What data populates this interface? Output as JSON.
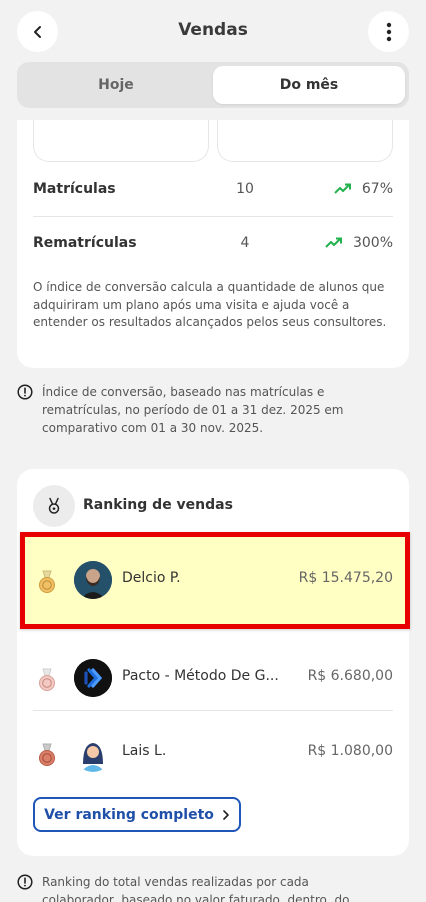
{
  "header": {
    "title": "Vendas",
    "back_icon": "chevron-left-icon",
    "more_icon": "more-vertical-icon"
  },
  "tabs": [
    {
      "label": "Hoje",
      "selected": false
    },
    {
      "label": "Do mês",
      "selected": true
    }
  ],
  "conversion": {
    "rows": [
      {
        "label": "Matrículas",
        "value": "10",
        "trend": "67%",
        "trend_icon": "trend-up-icon",
        "trend_color": "#22b14c"
      },
      {
        "label": "Rematrículas",
        "value": "4",
        "trend": "300%",
        "trend_icon": "trend-up-icon",
        "trend_color": "#22b14c"
      }
    ],
    "explanation": "O índice de conversão calcula a quantidade de alunos que adquiriram um plano após uma visita e ajuda você a entender os resultados alcançados pelos seus consultores."
  },
  "conversion_note": "Índice de conversão, baseado nas matrículas e rematrículas, no período de 01 a 31 dez. 2025 em comparativo com 01 a 30 nov. 2025.",
  "ranking": {
    "title": "Ranking de vendas",
    "icon": "medal-icon",
    "items": [
      {
        "medal": "gold",
        "name": "Delcio P.",
        "value": "R$ 15.475,20"
      },
      {
        "medal": "silver",
        "name": "Pacto - Método De G...",
        "value": "R$ 6.680,00"
      },
      {
        "medal": "bronze",
        "name": "Lais L.",
        "value": "R$ 1.080,00"
      }
    ],
    "button_label": "Ver ranking completo",
    "highlight_color": "#e60000"
  },
  "ranking_note": "Ranking do total vendas realizadas por cada colaborador, baseado no valor faturado, dentro, do"
}
